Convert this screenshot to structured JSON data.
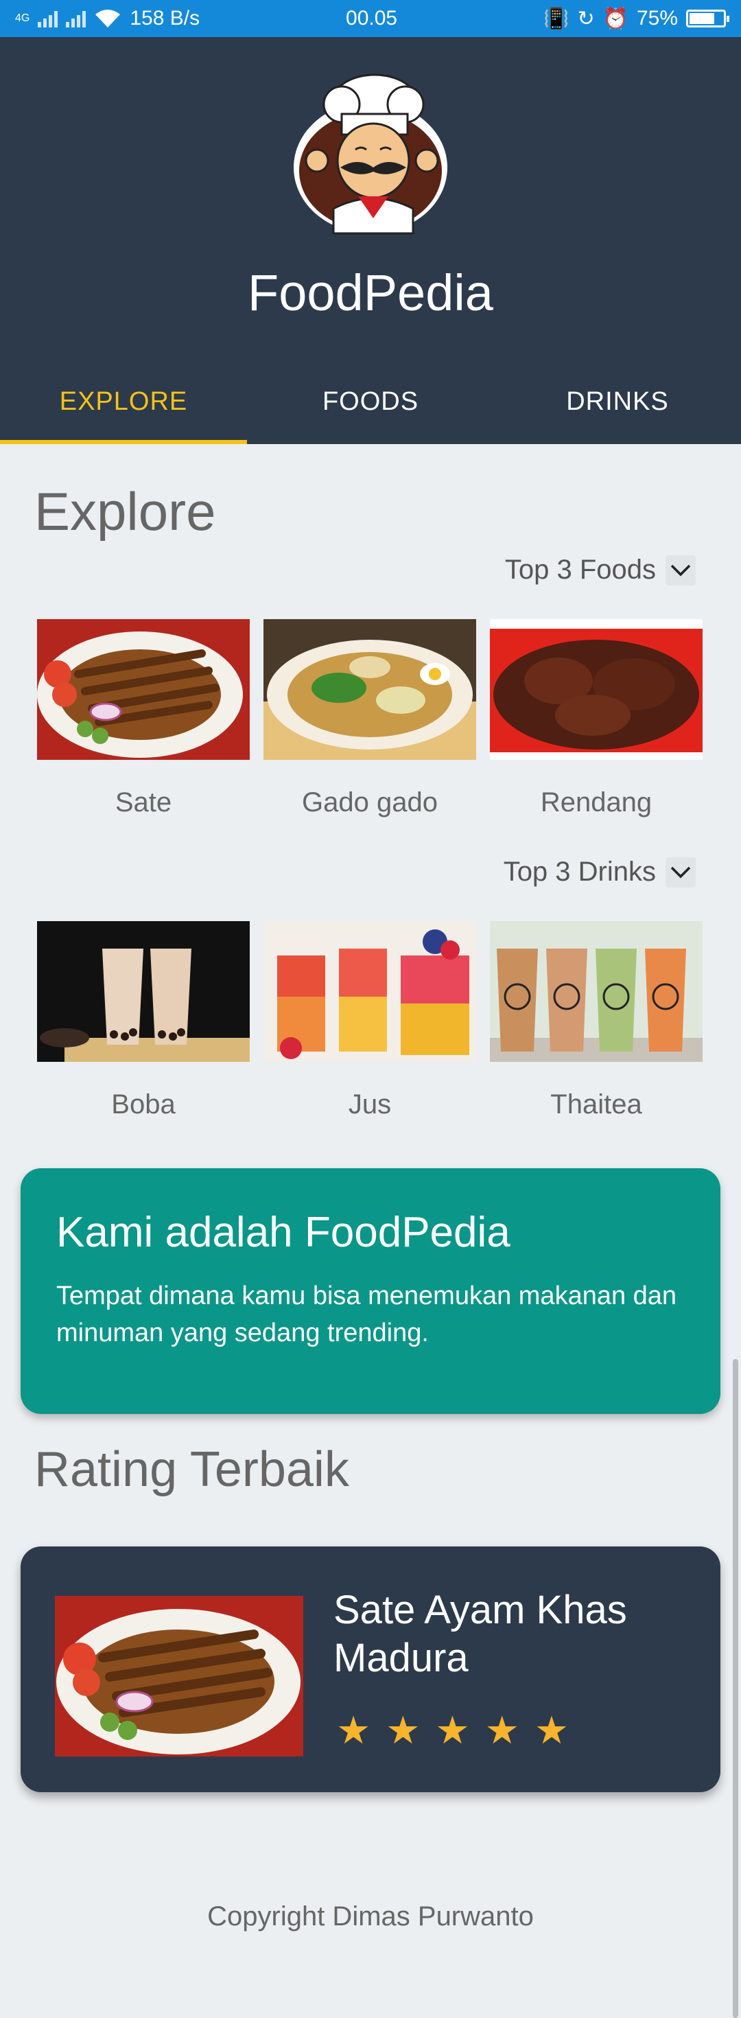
{
  "status_bar": {
    "network": "4G",
    "speed": "158 B/s",
    "time": "00.05",
    "battery": "75%",
    "battery_level": 0.75
  },
  "header": {
    "app_title": "FoodPedia",
    "tabs": [
      {
        "label": "EXPLORE",
        "active": true
      },
      {
        "label": "FOODS",
        "active": false
      },
      {
        "label": "DRINKS",
        "active": false
      }
    ]
  },
  "explore": {
    "title": "Explore",
    "foods_dropdown": "Top 3 Foods",
    "foods": [
      {
        "label": "Sate"
      },
      {
        "label": "Gado gado"
      },
      {
        "label": "Rendang"
      }
    ],
    "drinks_dropdown": "Top 3 Drinks",
    "drinks": [
      {
        "label": "Boba"
      },
      {
        "label": "Jus"
      },
      {
        "label": "Thaitea"
      }
    ]
  },
  "about": {
    "title": "Kami adalah FoodPedia",
    "text": "Tempat dimana kamu bisa menemukan makanan dan minuman yang sedang trending."
  },
  "rating": {
    "title": "Rating Terbaik",
    "item_name": "Sate Ayam Khas Madura",
    "stars": 5
  },
  "footer": {
    "copyright": "Copyright Dimas Purwanto"
  },
  "colors": {
    "status_bar": "#1589d9",
    "header": "#2d3a4b",
    "accent": "#f5c318",
    "about_card": "#0a9688",
    "star": "#f7b42c"
  }
}
